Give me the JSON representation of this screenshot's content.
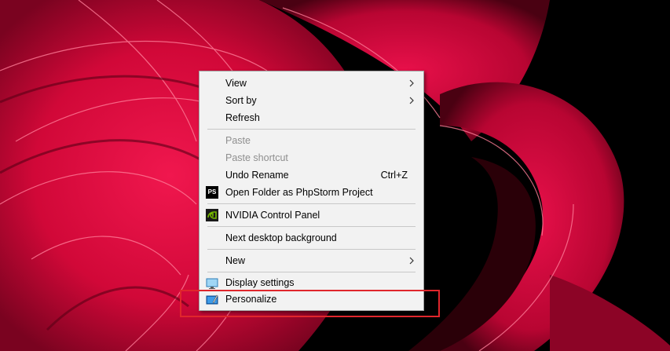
{
  "menu": {
    "view": "View",
    "sort_by": "Sort by",
    "refresh": "Refresh",
    "paste": "Paste",
    "paste_shortcut": "Paste shortcut",
    "undo_rename": "Undo Rename",
    "undo_rename_shortcut": "Ctrl+Z",
    "open_folder_phpstorm": "Open Folder as PhpStorm Project",
    "phpstorm_icon_text": "PS",
    "nvidia_control_panel": "NVIDIA Control Panel",
    "next_desktop_background": "Next desktop background",
    "new": "New",
    "display_settings": "Display settings",
    "personalize": "Personalize"
  },
  "icons": {
    "submenu": "chevron-right-icon",
    "phpstorm": "phpstorm-icon",
    "nvidia": "nvidia-icon",
    "display": "display-settings-icon",
    "personalize": "personalize-icon"
  },
  "colors": {
    "menu_background": "#f2f2f2",
    "disabled_text": "#8f8f8f",
    "highlight": "#e0262c",
    "wallpaper_red": "#e3063f",
    "nvidia_green": "#76b900"
  }
}
